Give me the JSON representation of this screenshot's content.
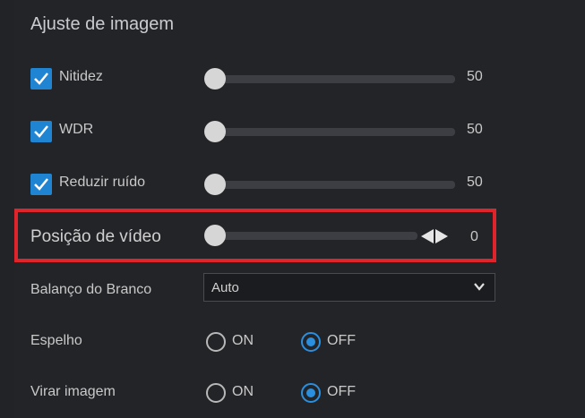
{
  "section_title": "Ajuste de imagem",
  "sliders": [
    {
      "label": "Nitidez",
      "checked": true,
      "value": "50",
      "level": 0.0
    },
    {
      "label": "WDR",
      "checked": true,
      "value": "50",
      "level": 0.0
    },
    {
      "label": "Reduzir ruído",
      "checked": true,
      "value": "50",
      "level": 0.0
    }
  ],
  "video_position": {
    "label": "Posição de vídeo",
    "value": "0"
  },
  "white_balance": {
    "label": "Balanço do Branco",
    "selected": "Auto"
  },
  "mirror": {
    "label": "Espelho",
    "on_label": "ON",
    "off_label": "OFF",
    "selected": "OFF"
  },
  "flip": {
    "label": "Virar imagem",
    "on_label": "ON",
    "off_label": "OFF",
    "selected": "OFF"
  },
  "colors": {
    "accent": "#1f85d3",
    "highlight_border": "#e0242b",
    "background": "#232427"
  }
}
